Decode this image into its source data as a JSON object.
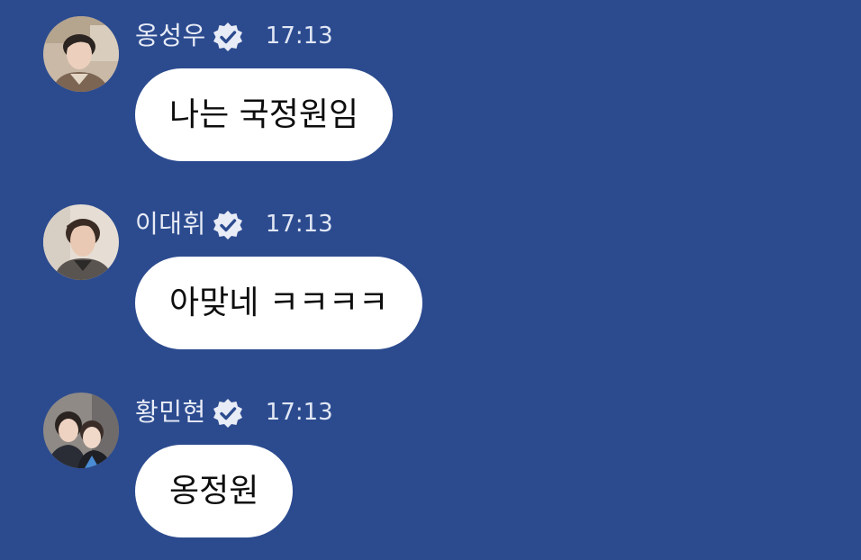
{
  "messages": [
    {
      "name": "옹성우",
      "time": "17:13",
      "text": "나는 국정원임",
      "avatar_icon": "user-photo-avatar",
      "verified_icon": "verified-badge-icon"
    },
    {
      "name": "이대휘",
      "time": "17:13",
      "text": "아맞네 ㅋㅋㅋㅋ",
      "avatar_icon": "user-photo-avatar",
      "verified_icon": "verified-badge-icon"
    },
    {
      "name": "황민현",
      "time": "17:13",
      "text": "옹정원",
      "avatar_icon": "user-photo-avatar",
      "verified_icon": "verified-badge-icon"
    }
  ],
  "colors": {
    "background": "#2c4b8f",
    "bubble": "#ffffff",
    "text": "#0d0d0d",
    "meta_text": "#e8ecf6",
    "badge": "#e8ecf6"
  }
}
